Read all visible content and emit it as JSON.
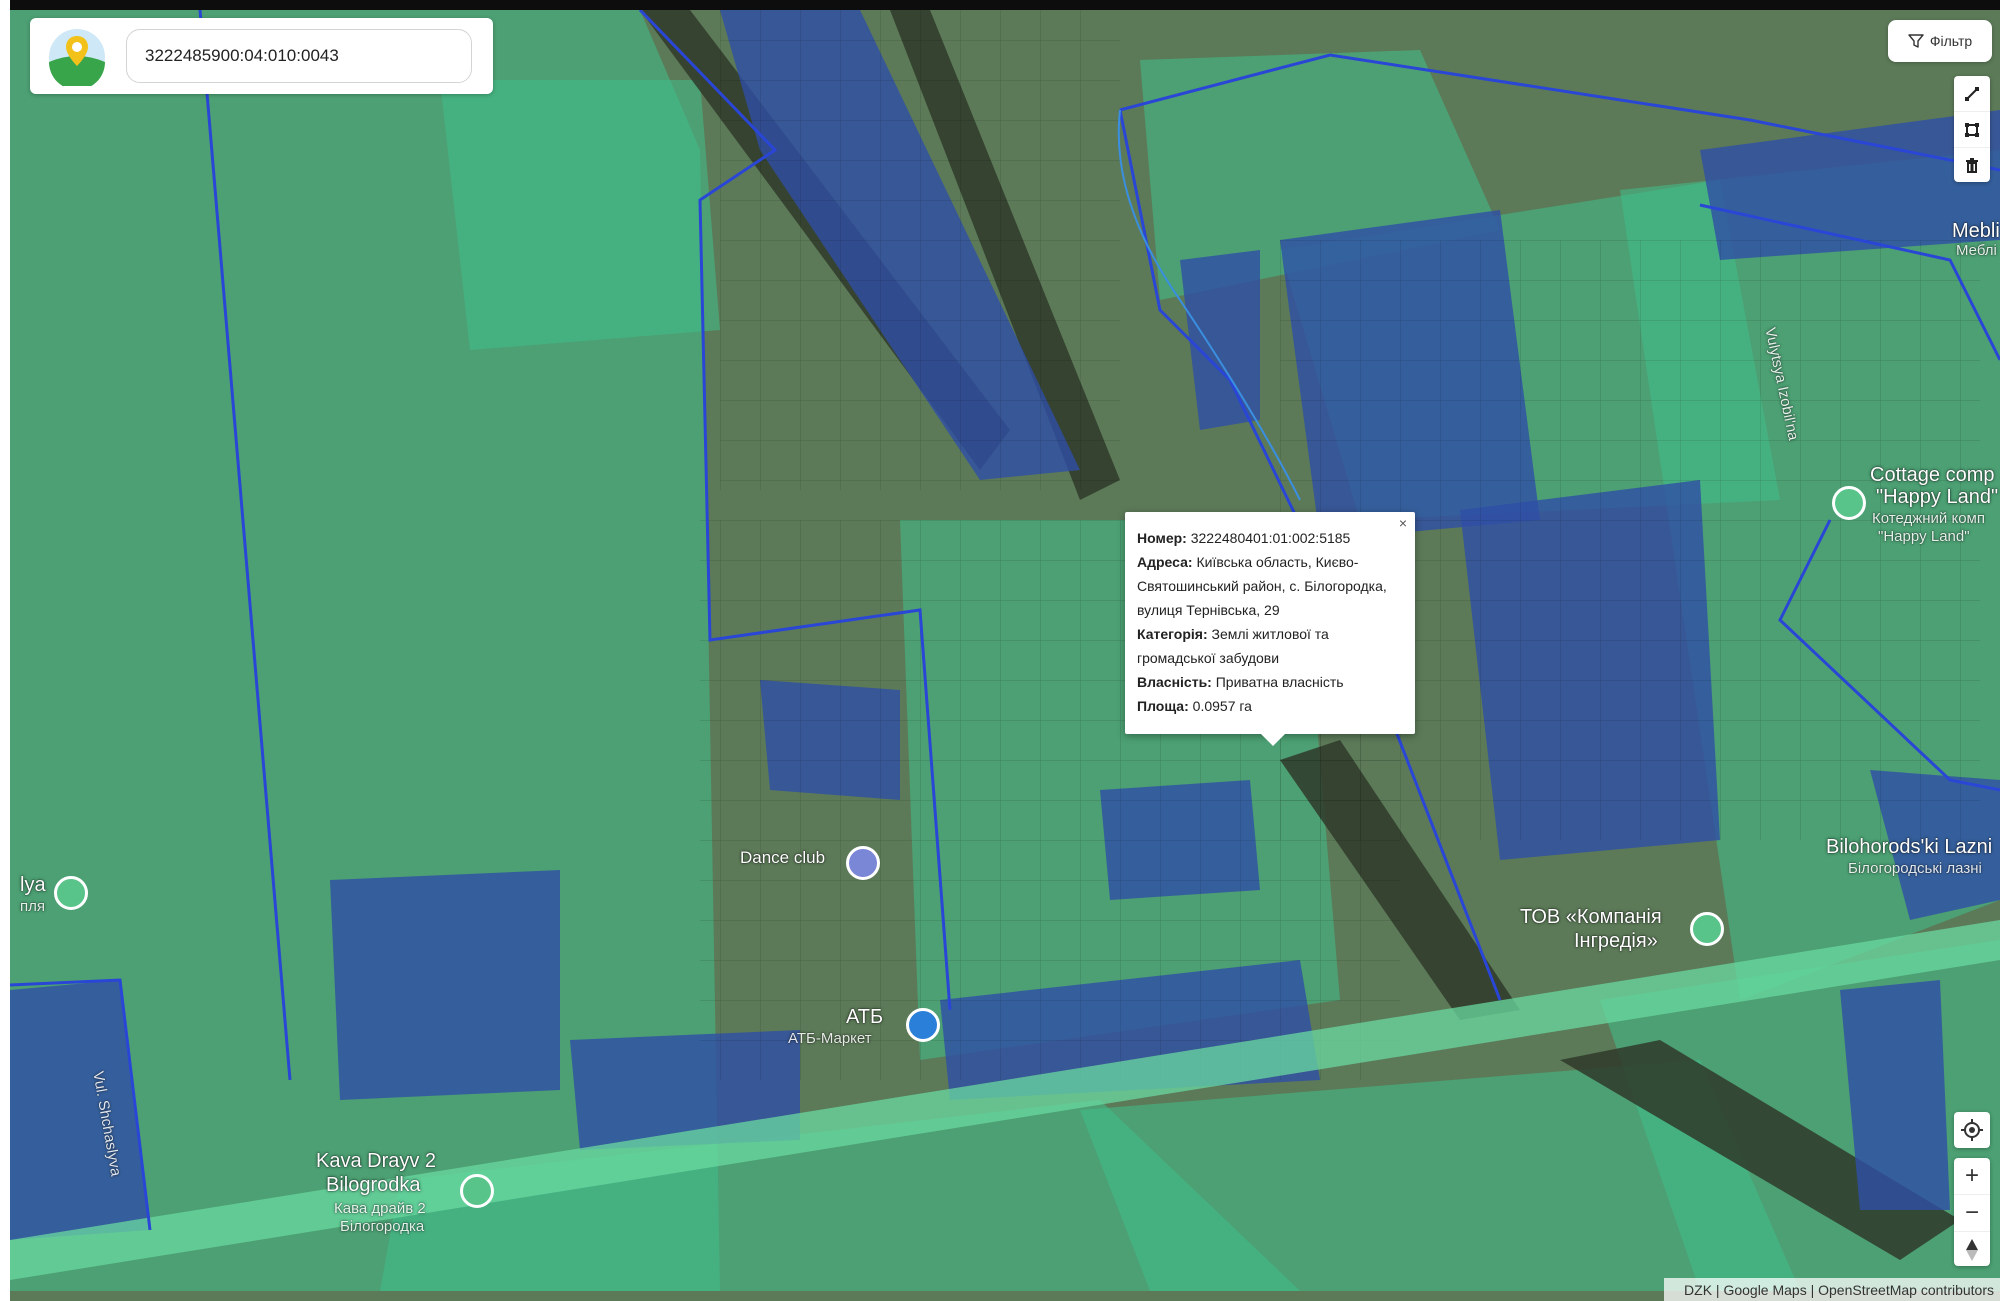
{
  "search": {
    "value": "3222485900:04:010:0043"
  },
  "controls": {
    "filter_label": "Фільтр",
    "draw_tools": [
      "line-draw-icon",
      "polygon-draw-icon",
      "trash-icon"
    ],
    "zoom_in": "+",
    "zoom_out": "−"
  },
  "attribution": "DZK | Google Maps | OpenStreetMap contributors",
  "popup": {
    "close": "×",
    "rows": [
      {
        "label": "Номер:",
        "value": " 3222480401:01:002:5185"
      },
      {
        "label": "Адреса:",
        "value": " Київська область, Києво-Святошинський район, с. Білогородка, вулиця Тернівська, 29"
      },
      {
        "label": "Категорія:",
        "value": " Землі житлової та громадської забудови"
      },
      {
        "label": "Власність:",
        "value": " Приватна власність"
      },
      {
        "label": "Площа:",
        "value": " 0.0957 га"
      }
    ]
  },
  "map_labels": {
    "dance_club": "Dance club",
    "atb": "АТБ",
    "atb_market": "АТБ-Маркет",
    "kava_drayv_1": "Kava Drayv 2",
    "kava_drayv_2": "Bilogrodka",
    "kava_drayv_3": "Кава драйв 2",
    "kava_drayv_4": "Білогородка",
    "tov_1": "ТОВ «Компанія",
    "tov_2": "Інгредія»",
    "cottage_1": "Cottage comp",
    "cottage_2": "\"Happy Land\"",
    "cottage_3": "Котеджний комп",
    "cottage_4": "\"Happy Land\"",
    "bilohorodski_1": "Bilohorods'ki Lazni",
    "bilohorodski_2": "Білогородські лазні",
    "mebli_1": "Mebli",
    "mebli_2": "Меблі",
    "street_vul_shchaslyva": "Vul. Shchaslyva",
    "street_izobilna": "Vulytsya Izobil'na",
    "left_edge_1": "lya",
    "left_edge_2": "пля"
  },
  "colors": {
    "parcel_green": "#3fbf8a",
    "parcel_blue": "#2f4fa6",
    "boundary_blue": "#2a46d6",
    "road_green": "#6ad9a0"
  }
}
